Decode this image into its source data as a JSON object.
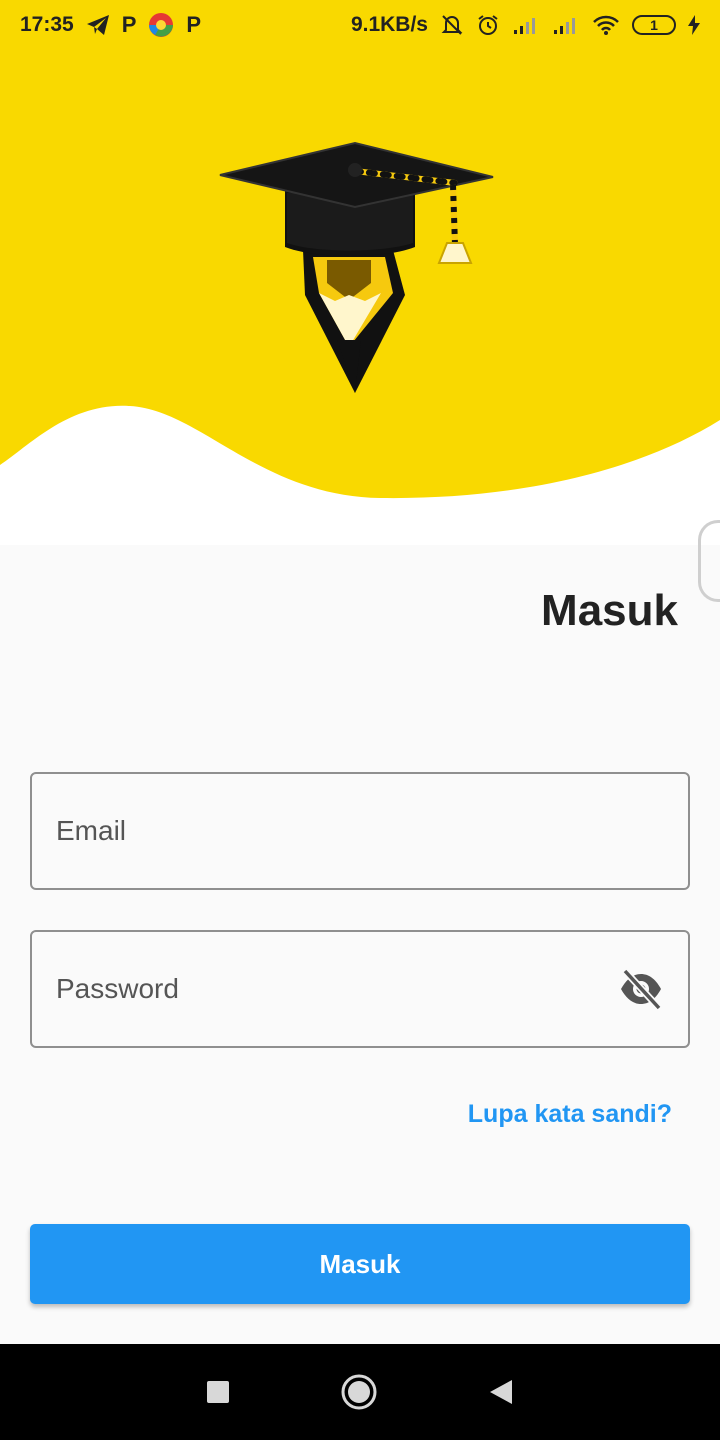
{
  "status_bar": {
    "time": "17:35",
    "net_speed": "9.1KB/s",
    "battery_level": "1",
    "left_icons": [
      "telegram-icon",
      "p-app-icon",
      "chrome-color-icon",
      "p-app-icon"
    ],
    "right_icons": [
      "silent-icon",
      "alarm-icon",
      "signal-icon",
      "signal-icon",
      "wifi-icon",
      "battery-icon",
      "charging-icon"
    ]
  },
  "header": {
    "background_color": "#f9d900",
    "logo_icon": "graduation-cap-pencil-icon"
  },
  "login": {
    "title": "Masuk",
    "email_placeholder": "Email",
    "password_placeholder": "Password",
    "password_toggle_icon": "eye-off-icon",
    "forgot_password": "Lupa kata sandi?",
    "submit_label": "Masuk",
    "accent_color": "#2196f3"
  },
  "nav_bar": {
    "buttons": [
      "recent-apps-icon",
      "home-icon",
      "back-icon"
    ]
  }
}
